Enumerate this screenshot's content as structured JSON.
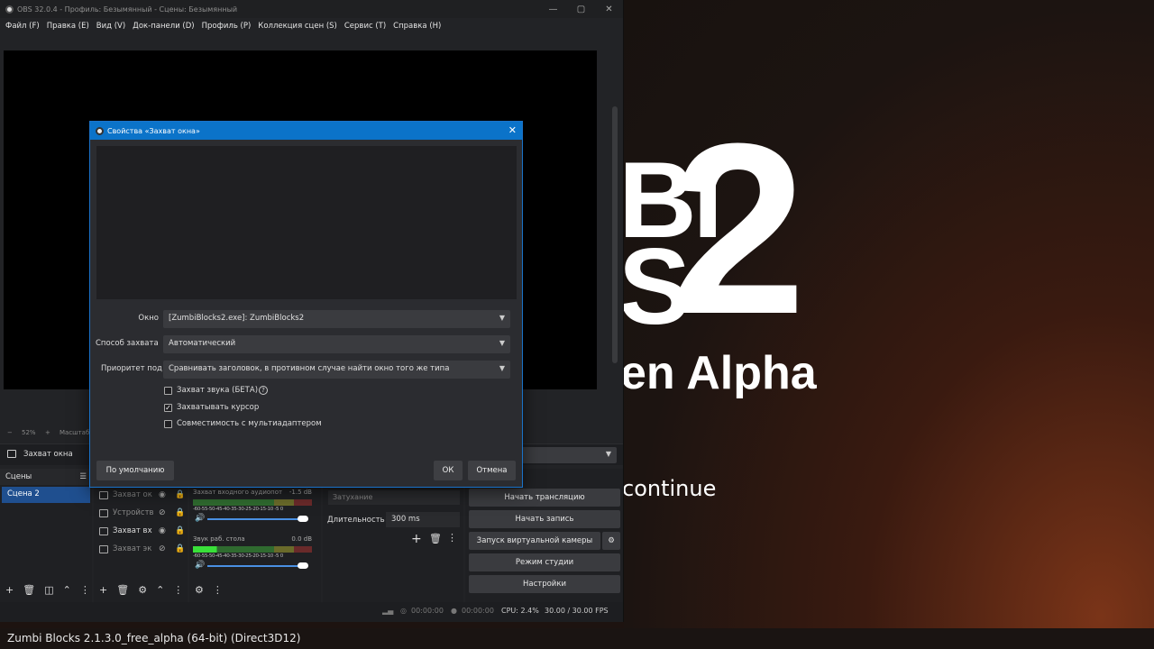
{
  "obs": {
    "title": "OBS 32.0.4 - Профиль: Безымянный - Сцены: Безымянный",
    "window_buttons": [
      "—",
      "▢",
      "✕"
    ],
    "menu": [
      "Файл (F)",
      "Правка (E)",
      "Вид (V)",
      "Док-панели (D)",
      "Профиль (P)",
      "Коллекция сцен (S)",
      "Сервис (T)",
      "Справка (H)"
    ],
    "zoom": "52%",
    "zoom_label": "Масштаб",
    "source_toolbar": {
      "name": "Захват окна"
    },
    "scenes": {
      "title": "Сцены",
      "items": [
        "Сцена 2"
      ]
    },
    "sources": [
      "Захват ок",
      "Устройств",
      "Захват вх",
      "Захват эк"
    ],
    "mixer": [
      {
        "name": "Захват входного аудиопот",
        "db": "-1.5 dB",
        "ticks": "-60-55-50-45-40-35-30-25-20-15-10 -5 0"
      },
      {
        "name": "Звук раб. стола",
        "db": "0.0 dB",
        "ticks": "-60-55-50-45-40-35-30-25-20-15-10 -5 0"
      }
    ],
    "transition": {
      "combo": "Затухание",
      "duration_label": "Длительность",
      "duration": "300 ms"
    },
    "controls": [
      "Начать трансляцию",
      "Начать запись",
      "Запуск виртуальной камеры",
      "Режим студии",
      "Настройки"
    ],
    "status": {
      "stream_time": "00:00:00",
      "rec_time": "00:00:00",
      "cpu": "CPU: 2.4%",
      "fps": "30.00 / 30.00 FPS"
    }
  },
  "dialog": {
    "title": "Свойства «Захват окна»",
    "window_label": "Окно",
    "window_value": "[ZumbiBlocks2.exe]: ZumbiBlocks2",
    "method_label": "Способ захвата",
    "method_value": "Автоматический",
    "priority_label": "Приоритет подб",
    "priority_value": "Сравнивать заголовок, в противном случае найти окно того же типа",
    "checkboxes": [
      {
        "label": "Захват звука (БЕТА)",
        "checked": false
      },
      {
        "label": "Захватывать курсор",
        "checked": true
      },
      {
        "label": "Совместимость с мультиадаптером",
        "checked": false
      }
    ],
    "defaults_button": "По умолчанию",
    "ok_button": "ОК",
    "cancel_button": "Отмена"
  },
  "game": {
    "row1": "BI",
    "row2": "S",
    "big_number": "2",
    "subtitle": "en Alpha",
    "continue": "continue",
    "taskbar_title": "Zumbi Blocks 2.1.3.0_free_alpha (64-bit) (Direct3D12)"
  }
}
